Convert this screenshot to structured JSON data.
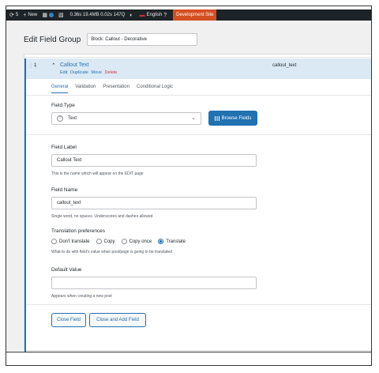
{
  "admin_bar": {
    "update_count": "5",
    "new_label": "New",
    "perf": "0.36s  19.4MB  0.02s  147Q",
    "language": "English",
    "dev_site": "Development Site"
  },
  "page": {
    "title": "Edit Field Group",
    "group_title_value": "Block: Callout - Decorative"
  },
  "field": {
    "order": "1",
    "label": "Callout Text",
    "name": "callout_text",
    "actions": {
      "edit": "Edit",
      "duplicate": "Duplicate",
      "move": "Move",
      "delete": "Delete"
    }
  },
  "tabs": [
    "General",
    "Validation",
    "Presentation",
    "Conditional Logic"
  ],
  "settings": {
    "field_type_label": "Field Type",
    "field_type_value": "Text",
    "browse_label": "Browse Fields",
    "field_label_label": "Field Label",
    "field_label_value": "Callout Text",
    "field_label_hint": "This is the name which will appear on the EDIT page",
    "field_name_label": "Field Name",
    "field_name_value": "callout_text",
    "field_name_hint": "Single word, no spaces. Underscores and dashes allowed",
    "translation_label": "Translation preferences",
    "translation_options": [
      "Don't translate",
      "Copy",
      "Copy once",
      "Translate"
    ],
    "translation_selected": "Translate",
    "translation_hint": "What to do with field's value when post/page is going to be translated",
    "default_value_label": "Default Value",
    "default_value_value": "",
    "default_value_hint": "Appears when creating a new post"
  },
  "buttons": {
    "close_field": "Close Field",
    "close_add": "Close and Add Field"
  }
}
